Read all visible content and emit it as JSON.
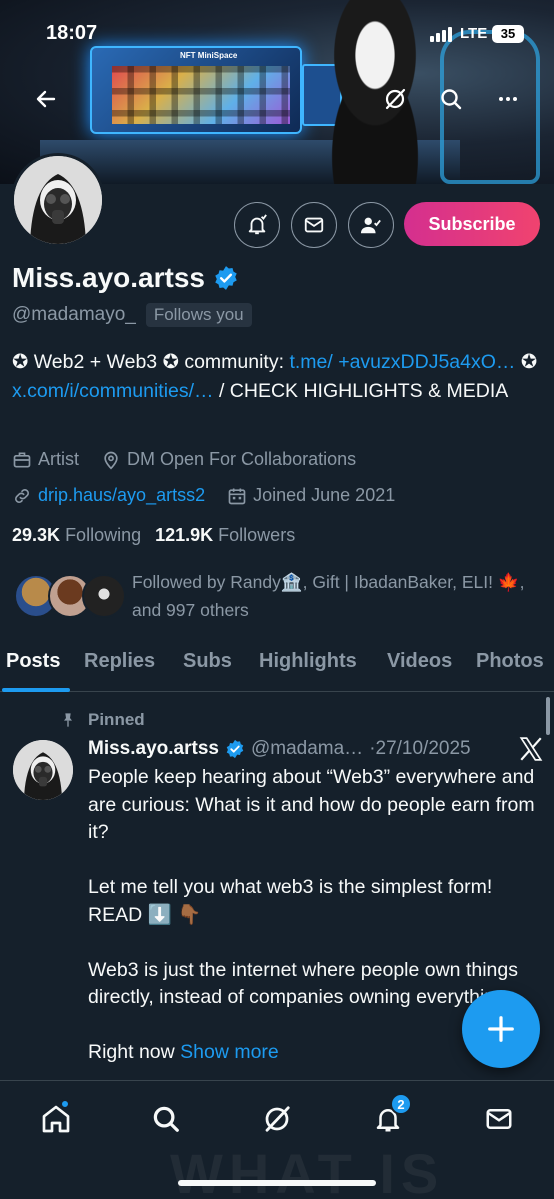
{
  "status_bar": {
    "time": "18:07",
    "network": "LTE",
    "battery": "35"
  },
  "banner": {
    "monitor_title": "NFT MiniSpace"
  },
  "profile": {
    "name": "Miss.ayo.artss",
    "handle": "@madamayo_",
    "follows_you": "Follows you",
    "bio_part1": "✪ Web2 + Web3 ✪ community: ",
    "bio_link1": "t.me/ +avuzxDDJ5a4xO…",
    "bio_part2": " ✪ ",
    "bio_link2": "x.com/i/communities/…",
    "bio_part3": " / CHECK HIGHLIGHTS & MEDIA",
    "category": "Artist",
    "location": "DM Open For Collaborations",
    "website": "drip.haus/ayo_artss2",
    "joined": "Joined June 2021",
    "following_count": "29.3K",
    "following_label": "Following",
    "followers_count": "121.9K",
    "followers_label": "Followers",
    "followed_by": "Followed by Randy🏦, Gift | IbadanBaker, ELI! 🍁, and 997 others"
  },
  "actions": {
    "subscribe_label": "Subscribe"
  },
  "tabs": [
    {
      "label": "Posts"
    },
    {
      "label": "Replies"
    },
    {
      "label": "Subs"
    },
    {
      "label": "Highlights"
    },
    {
      "label": "Videos"
    },
    {
      "label": "Photos"
    }
  ],
  "post": {
    "pinned_label": "Pinned",
    "author_name": "Miss.ayo.artss",
    "author_handle": "@madama…",
    "date": "·27/10/2025",
    "paragraphs": [
      "People keep hearing about “Web3” everywhere and are curious: What is it and how do people earn from it?",
      "Let me tell you what web3 is the simplest form! READ ⬇️ 👇🏾",
      "Web3 is just the internet where people own things directly, instead of companies owning everything."
    ],
    "last_line": "Right now ",
    "show_more": "Show more"
  },
  "bottom_nav": {
    "notifications_badge": "2",
    "faded_text": "WHAT IS"
  },
  "colors": {
    "background": "#15202b",
    "accent": "#1d9bf0",
    "subscribe_start": "#d42f8f",
    "subscribe_end": "#f0436f",
    "muted": "#8b98a5"
  }
}
